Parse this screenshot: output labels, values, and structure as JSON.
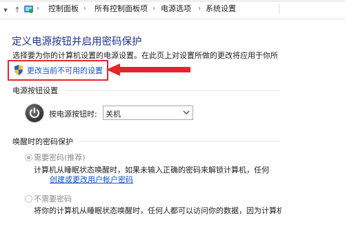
{
  "addressbar": {
    "crumbs": [
      "控制面板",
      "所有控制面板项",
      "电源选项",
      "系统设置"
    ]
  },
  "page": {
    "title": "定义电源按钮并启用密码保护",
    "description": "选择要为你的计算机设置的电源设置。在此页上对设置所做的更改将应用于你所",
    "change_link": "更改当前不可用的设置"
  },
  "power_button_section": {
    "title": "电源按钮设置",
    "label": "按电源按钮时:",
    "selected_value": "关机"
  },
  "wake_password_section": {
    "title": "唤醒时的密码保护",
    "options": [
      {
        "label": "需要密码(推荐)",
        "text": "计算机从睡眠状态唤醒时，如果未输入正确的密码来解锁计算机，任何",
        "link": "创建或更改用户帐户密码"
      },
      {
        "label": "不需要密码",
        "text": "将你的计算机从睡眠状态唤醒时，任何人都可以访问你的数据，因为计算机"
      }
    ]
  },
  "colors": {
    "title": "#1e3287",
    "link": "#0d55c7",
    "highlight": "#e5242b"
  }
}
